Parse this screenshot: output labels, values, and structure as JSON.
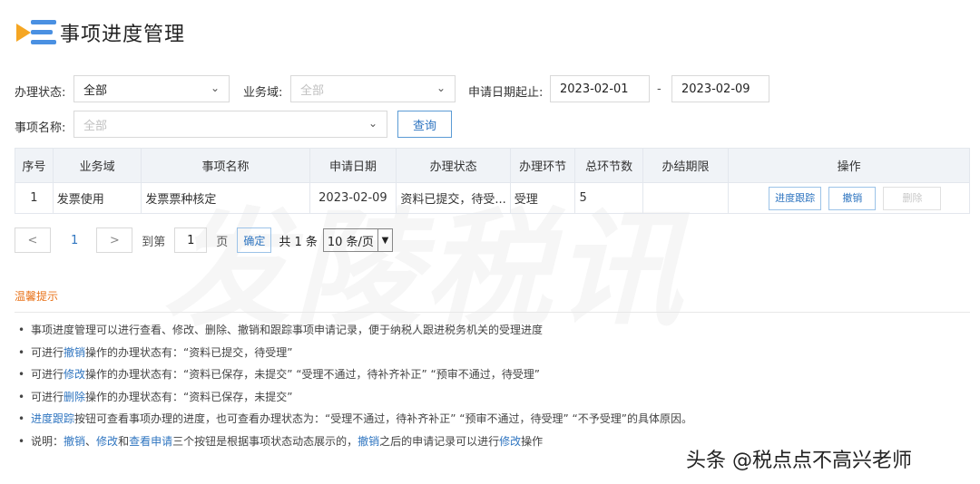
{
  "header": {
    "title": "事项进度管理",
    "logo_icon": "list-play-icon"
  },
  "filters": {
    "status_label": "办理状态:",
    "status_value": "全部",
    "domain_label": "业务域:",
    "domain_placeholder": "全部",
    "date_label": "申请日期起止:",
    "date_start": "2023-02-01",
    "date_sep": "-",
    "date_end": "2023-02-09",
    "item_label": "事项名称:",
    "item_placeholder": "全部",
    "query_button": "查询"
  },
  "table": {
    "headers": [
      "序号",
      "业务域",
      "事项名称",
      "申请日期",
      "办理状态",
      "办理环节",
      "总环节数",
      "办结期限",
      "操作"
    ],
    "rows": [
      {
        "index": "1",
        "domain": "发票使用",
        "item": "发票票种核定",
        "date": "2023-02-09",
        "status": "资料已提交，待受...",
        "stage": "受理",
        "total": "5",
        "deadline": "",
        "actions": [
          "进度跟踪",
          "撤销",
          "删除"
        ]
      }
    ]
  },
  "pager": {
    "prev": "<",
    "current": "1",
    "next": ">",
    "goto_prefix": "到第",
    "goto_value": "1",
    "goto_suffix": "页",
    "confirm": "确定",
    "total": "共 1 条",
    "page_size": "10 条/页"
  },
  "watermark": "发陵税讯",
  "tips": {
    "title": "温馨提示",
    "items": [
      [
        "",
        "事项进度管理可以进行查看、修改、删除、撤销和跟踪事项申请记录，便于纳税人跟进税务机关的受理进度"
      ],
      [
        "可进行",
        "撤销",
        "操作的办理状态有：“资料已提交，待受理”"
      ],
      [
        "可进行",
        "修改",
        "操作的办理状态有：“资料已保存，未提交” “受理不通过，待补齐补正” “预审不通过，待受理”"
      ],
      [
        "可进行",
        "删除",
        "操作的办理状态有：“资料已保存，未提交”"
      ],
      [
        "",
        "进度跟踪",
        "按钮可查看事项办理的进度，也可查看办理状态为：“受理不通过，待补齐补正” “预审不通过，待受理” “不予受理”的具体原因。"
      ]
    ],
    "last": {
      "a": "说明：",
      "b": "撤销",
      "c": "、",
      "d": "修改",
      "e": "和",
      "f": "查看申请",
      "g": "三个按钮是根据事项状态动态展示的，",
      "h": "撤销",
      "i": "之后的申请记录可以进行",
      "j": "修改",
      "k": "操作"
    }
  },
  "credit": "头条 @税点点不高兴老师",
  "colors": {
    "accent": "#2f75c0",
    "tip_title": "#e8731a",
    "logo_orange": "#f5a623",
    "logo_blue": "#4a90e2"
  }
}
